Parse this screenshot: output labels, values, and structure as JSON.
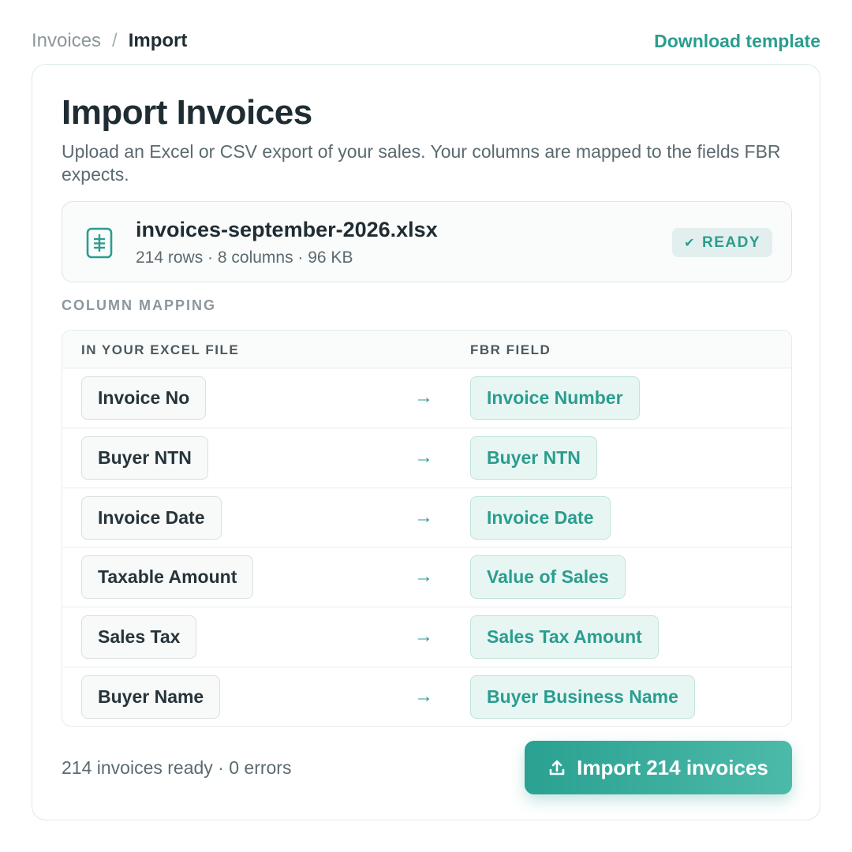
{
  "breadcrumb": {
    "parent": "Invoices",
    "separator": "/",
    "current": "Import"
  },
  "header": {
    "download_template": "Download template"
  },
  "page": {
    "title": "Import Invoices",
    "description": "Upload an Excel or CSV export of your sales. Your columns are mapped to the fields FBR expects."
  },
  "file": {
    "name": "invoices-september-2026.xlsx",
    "meta": "214 rows · 8 columns · 96 KB",
    "status": "READY",
    "status_icon": "check-icon"
  },
  "mapping": {
    "section_label": "COLUMN MAPPING",
    "col_source": "IN YOUR EXCEL FILE",
    "col_target": "FBR FIELD",
    "arrow": "→",
    "rows": [
      {
        "source": "Invoice No",
        "target": "Invoice Number"
      },
      {
        "source": "Buyer NTN",
        "target": "Buyer NTN"
      },
      {
        "source": "Invoice Date",
        "target": "Invoice Date"
      },
      {
        "source": "Taxable Amount",
        "target": "Value of Sales"
      },
      {
        "source": "Sales Tax",
        "target": "Sales Tax Amount"
      },
      {
        "source": "Buyer Name",
        "target": "Buyer Business Name"
      }
    ]
  },
  "footer": {
    "summary": "214 invoices ready · 0 errors",
    "import_button": "Import 214 invoices",
    "import_icon": "upload-icon"
  },
  "colors": {
    "accent": "#2a9d8f",
    "text": "#1f2d33",
    "muted": "#5b6a70"
  }
}
